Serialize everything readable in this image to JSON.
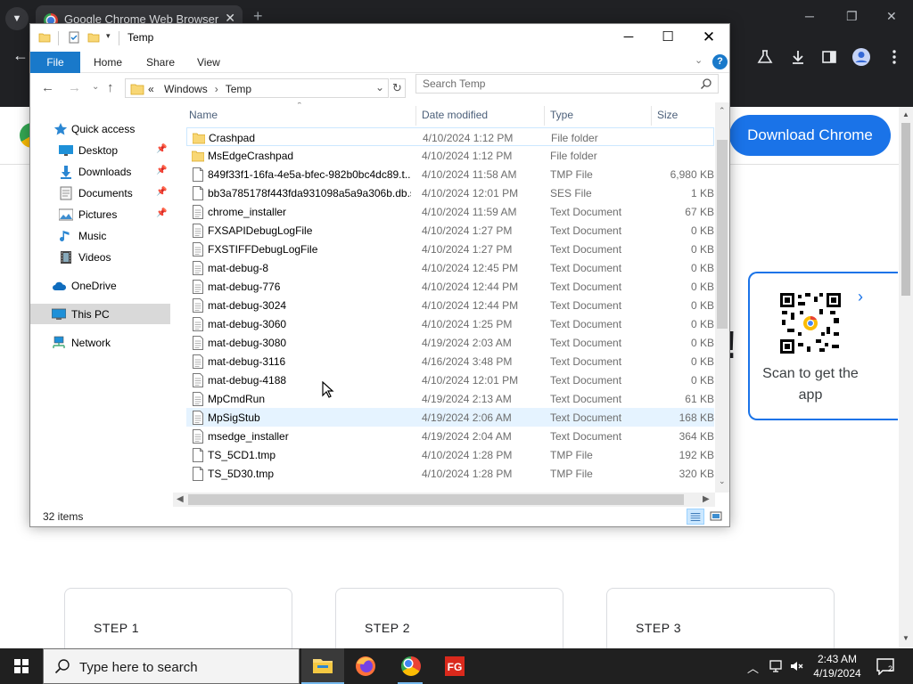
{
  "browser": {
    "tab_title": "Google Chrome Web Browser",
    "tab_close": "✕",
    "new_tab": "+",
    "download_label": "Download Chrome",
    "qr_text": "Scan to get the app",
    "steps": [
      "STEP 1",
      "STEP 2",
      "STEP 3"
    ]
  },
  "explorer": {
    "title": "Temp",
    "ribbon": {
      "file": "File",
      "tabs": [
        "Home",
        "Share",
        "View"
      ],
      "help": "?"
    },
    "address": {
      "overflow": "«",
      "parts": [
        "Windows",
        "Temp"
      ]
    },
    "search_placeholder": "Search Temp",
    "nav_pane": [
      {
        "label": "Quick access",
        "icon": "star-icon"
      },
      {
        "label": "Desktop",
        "icon": "desktop-icon",
        "pinned": true
      },
      {
        "label": "Downloads",
        "icon": "download-arrow-icon",
        "pinned": true
      },
      {
        "label": "Documents",
        "icon": "documents-icon",
        "pinned": true
      },
      {
        "label": "Pictures",
        "icon": "pictures-icon",
        "pinned": true
      },
      {
        "label": "Music",
        "icon": "music-icon"
      },
      {
        "label": "Videos",
        "icon": "videos-icon"
      },
      {
        "label": "OneDrive",
        "icon": "cloud-icon"
      },
      {
        "label": "This PC",
        "icon": "computer-icon",
        "selected": true
      },
      {
        "label": "Network",
        "icon": "network-icon"
      }
    ],
    "columns": [
      "Name",
      "Date modified",
      "Type",
      "Size"
    ],
    "files": [
      {
        "name": "Crashpad",
        "date": "4/10/2024 1:12 PM",
        "type": "File folder",
        "size": "",
        "kind": "folder"
      },
      {
        "name": "MsEdgeCrashpad",
        "date": "4/10/2024 1:12 PM",
        "type": "File folder",
        "size": "",
        "kind": "folder"
      },
      {
        "name": "849f33f1-16fa-4e5a-bfec-982b0bc4dc89.t...",
        "date": "4/10/2024 11:58 AM",
        "type": "TMP File",
        "size": "6,980 KB",
        "kind": "file"
      },
      {
        "name": "bb3a785178f443fda931098a5a9a306b.db.s...",
        "date": "4/10/2024 12:01 PM",
        "type": "SES File",
        "size": "1 KB",
        "kind": "file"
      },
      {
        "name": "chrome_installer",
        "date": "4/10/2024 11:59 AM",
        "type": "Text Document",
        "size": "67 KB",
        "kind": "text"
      },
      {
        "name": "FXSAPIDebugLogFile",
        "date": "4/10/2024 1:27 PM",
        "type": "Text Document",
        "size": "0 KB",
        "kind": "text"
      },
      {
        "name": "FXSTIFFDebugLogFile",
        "date": "4/10/2024 1:27 PM",
        "type": "Text Document",
        "size": "0 KB",
        "kind": "text"
      },
      {
        "name": "mat-debug-8",
        "date": "4/10/2024 12:45 PM",
        "type": "Text Document",
        "size": "0 KB",
        "kind": "text"
      },
      {
        "name": "mat-debug-776",
        "date": "4/10/2024 12:44 PM",
        "type": "Text Document",
        "size": "0 KB",
        "kind": "text"
      },
      {
        "name": "mat-debug-3024",
        "date": "4/10/2024 12:44 PM",
        "type": "Text Document",
        "size": "0 KB",
        "kind": "text"
      },
      {
        "name": "mat-debug-3060",
        "date": "4/10/2024 1:25 PM",
        "type": "Text Document",
        "size": "0 KB",
        "kind": "text"
      },
      {
        "name": "mat-debug-3080",
        "date": "4/19/2024 2:03 AM",
        "type": "Text Document",
        "size": "0 KB",
        "kind": "text"
      },
      {
        "name": "mat-debug-3116",
        "date": "4/16/2024 3:48 PM",
        "type": "Text Document",
        "size": "0 KB",
        "kind": "text"
      },
      {
        "name": "mat-debug-4188",
        "date": "4/10/2024 12:01 PM",
        "type": "Text Document",
        "size": "0 KB",
        "kind": "text"
      },
      {
        "name": "MpCmdRun",
        "date": "4/19/2024 2:13 AM",
        "type": "Text Document",
        "size": "61 KB",
        "kind": "text"
      },
      {
        "name": "MpSigStub",
        "date": "4/19/2024 2:06 AM",
        "type": "Text Document",
        "size": "168 KB",
        "kind": "text",
        "hover": true
      },
      {
        "name": "msedge_installer",
        "date": "4/19/2024 2:04 AM",
        "type": "Text Document",
        "size": "364 KB",
        "kind": "text"
      },
      {
        "name": "TS_5CD1.tmp",
        "date": "4/10/2024 1:28 PM",
        "type": "TMP File",
        "size": "192 KB",
        "kind": "file"
      },
      {
        "name": "TS_5D30.tmp",
        "date": "4/10/2024 1:28 PM",
        "type": "TMP File",
        "size": "320 KB",
        "kind": "file"
      }
    ],
    "status": "32 items"
  },
  "taskbar": {
    "search_text": "Type here to search",
    "apps": [
      "file-explorer-icon",
      "firefox-icon",
      "chrome-icon",
      "fortigate-icon"
    ],
    "time": "2:43 AM",
    "date": "4/19/2024"
  },
  "colors": {
    "accent": "#1979ca",
    "chrome_blue": "#1a73e8",
    "taskbar": "#202020",
    "chrome_frame": "#202124"
  }
}
